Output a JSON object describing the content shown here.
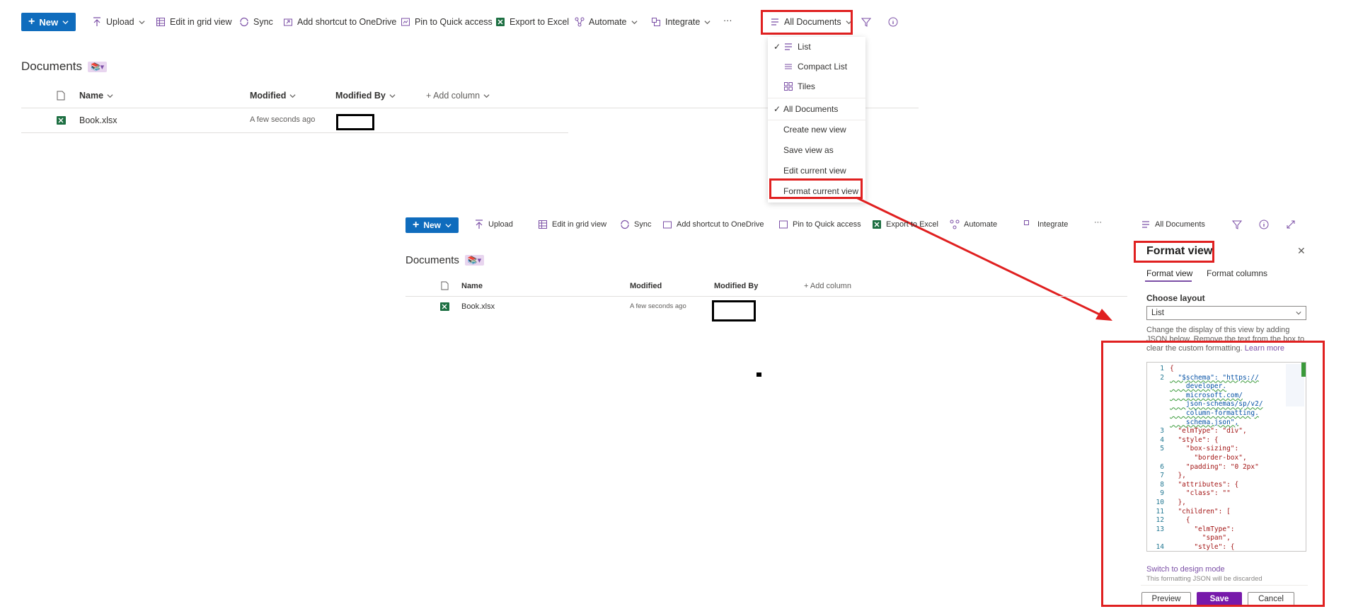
{
  "toolbar": {
    "new_label": "New",
    "upload_label": "Upload",
    "edit_grid_label": "Edit in grid view",
    "sync_label": "Sync",
    "shortcut_label": "Add shortcut to OneDrive",
    "pin_label": "Pin to Quick access",
    "export_label": "Export to Excel",
    "automate_label": "Automate",
    "integrate_label": "Integrate",
    "more_label": "···",
    "view_label": "All Documents"
  },
  "library": {
    "title": "Documents",
    "columns": {
      "name": "Name",
      "modified": "Modified",
      "modified_by": "Modified By",
      "add_column": "+ Add column"
    },
    "rows": [
      {
        "name": "Book.xlsx",
        "modified": "A few seconds ago"
      }
    ]
  },
  "view_menu": {
    "items": [
      "List",
      "Compact List",
      "Tiles",
      "All Documents",
      "Create new view",
      "Save view as",
      "Edit current view",
      "Format current view"
    ]
  },
  "format_pane": {
    "title": "Format view",
    "tabs": [
      "Format view",
      "Format columns"
    ],
    "choose_layout_label": "Choose layout",
    "layout_value": "List",
    "description": "Change the display of this view by adding JSON below. Remove the text from the box to clear the custom formatting.",
    "learn_more": "Learn more",
    "code_lines": [
      {
        "n": "1",
        "text": "{"
      },
      {
        "n": "2",
        "text": "  \"$schema\": \"https://"
      },
      {
        "n": "",
        "text": "    developer."
      },
      {
        "n": "",
        "text": "    microsoft.com/"
      },
      {
        "n": "",
        "text": "    json-schemas/sp/v2/"
      },
      {
        "n": "",
        "text": "    column-formatting."
      },
      {
        "n": "",
        "text": "    schema.json\","
      },
      {
        "n": "3",
        "text": "  \"elmType\": \"div\","
      },
      {
        "n": "4",
        "text": "  \"style\": {"
      },
      {
        "n": "5",
        "text": "    \"box-sizing\":"
      },
      {
        "n": "",
        "text": "      \"border-box\","
      },
      {
        "n": "6",
        "text": "    \"padding\": \"0 2px\""
      },
      {
        "n": "7",
        "text": "  },"
      },
      {
        "n": "8",
        "text": "  \"attributes\": {"
      },
      {
        "n": "9",
        "text": "    \"class\": \"\""
      },
      {
        "n": "10",
        "text": "  },"
      },
      {
        "n": "11",
        "text": "  \"children\": ["
      },
      {
        "n": "12",
        "text": "    {"
      },
      {
        "n": "13",
        "text": "      \"elmType\":"
      },
      {
        "n": "",
        "text": "        \"span\","
      },
      {
        "n": "14",
        "text": "      \"style\": {"
      }
    ],
    "switch_link": "Switch to design mode",
    "discard_note": "This formatting JSON will be discarded",
    "buttons": {
      "preview": "Preview",
      "save": "Save",
      "cancel": "Cancel"
    }
  },
  "colors": {
    "accent": "#7b4fa6",
    "primary_blue": "#0f6cbd",
    "highlight_red": "#e02020",
    "save_purple": "#7719aa"
  }
}
